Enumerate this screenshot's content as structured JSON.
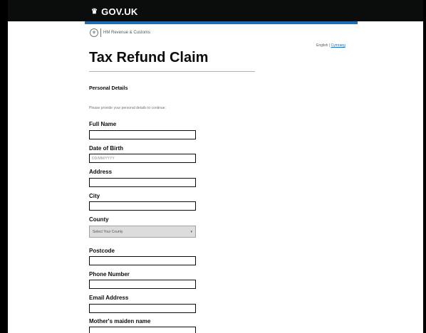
{
  "header": {
    "crown_glyph": "♛",
    "logo_text": "GOV.UK"
  },
  "department": {
    "name": "HM Revenue & Customs"
  },
  "language": {
    "current": "English",
    "separator": "|",
    "alternate": "Cymraeg"
  },
  "page": {
    "title": "Tax Refund Claim",
    "section_heading": "Personal Details",
    "hint": "Please provide your personal details to continue:"
  },
  "form": {
    "full_name": {
      "label": "Full Name",
      "value": ""
    },
    "dob": {
      "label": "Date of Birth",
      "placeholder": "DD/MM/YYYY",
      "value": ""
    },
    "address": {
      "label": "Address",
      "value": ""
    },
    "city": {
      "label": "City",
      "value": ""
    },
    "county": {
      "label": "County",
      "selected": "Select Your County"
    },
    "postcode": {
      "label": "Postcode",
      "value": ""
    },
    "phone": {
      "label": "Phone Number",
      "value": ""
    },
    "email": {
      "label": "Email Address",
      "value": ""
    },
    "maiden": {
      "label": "Mother's maiden name",
      "value": ""
    }
  },
  "colors": {
    "header_bg": "#0b0c0c",
    "accent_blue": "#1d70b8",
    "text": "#0b0c0c"
  }
}
